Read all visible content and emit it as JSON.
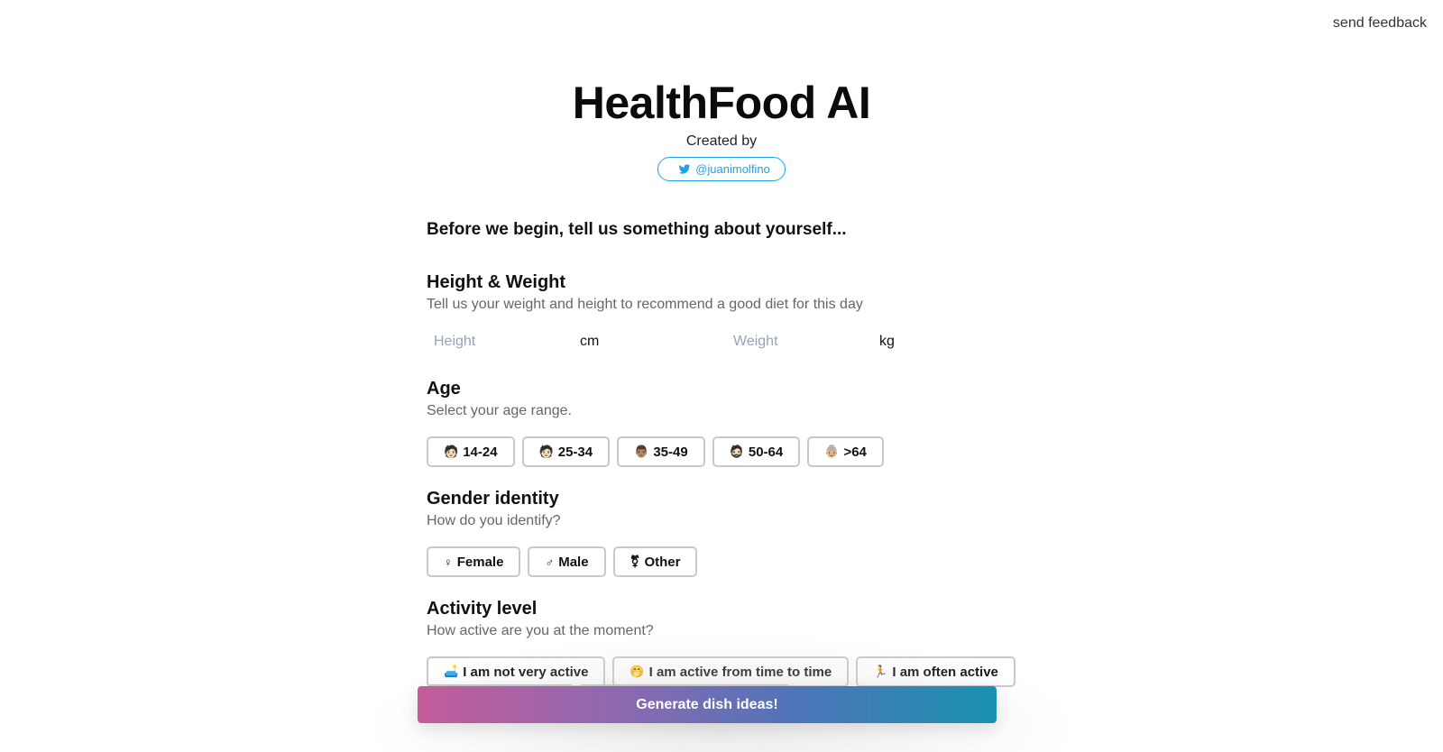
{
  "feedback": {
    "label": "send feedback"
  },
  "header": {
    "title": "HealthFood AI",
    "created_by": "Created by",
    "twitter_handle": "@juanimolfino",
    "twitter_icon": "twitter-bird-icon"
  },
  "intro": "Before we begin, tell us something about yourself...",
  "colors": {
    "twitter": "#1da1f2",
    "gradient_start": "#c45c9a",
    "gradient_end": "#1993b0",
    "border": "#c9c9c9"
  },
  "height_weight": {
    "title": "Height & Weight",
    "description": "Tell us your weight and height to recommend a good diet for this day",
    "height": {
      "placeholder": "Height",
      "value": "",
      "unit": "cm"
    },
    "weight": {
      "placeholder": "Weight",
      "value": "",
      "unit": "kg"
    }
  },
  "age": {
    "title": "Age",
    "description": "Select your age range.",
    "options": [
      {
        "icon": "🧑🏻",
        "label": "14-24"
      },
      {
        "icon": "🧑🏻",
        "label": "25-34"
      },
      {
        "icon": "👨🏽",
        "label": "35-49"
      },
      {
        "icon": "🧔🏻",
        "label": "50-64"
      },
      {
        "icon": "👵🏼",
        "label": ">64"
      }
    ]
  },
  "gender": {
    "title": "Gender identity",
    "description": "How do you identify?",
    "options": [
      {
        "icon": "♀",
        "label": "Female"
      },
      {
        "icon": "♂",
        "label": "Male"
      },
      {
        "icon": "⚧",
        "label": "Other"
      }
    ]
  },
  "activity": {
    "title": "Activity level",
    "description": "How active are you at the moment?",
    "options": [
      {
        "icon": "🛋️",
        "label": "I am not very active"
      },
      {
        "icon": "🤭",
        "label": "I am active from time to time"
      },
      {
        "icon": "🏃",
        "label": "I am often active"
      }
    ]
  },
  "generate": {
    "label": "Generate dish ideas!"
  }
}
